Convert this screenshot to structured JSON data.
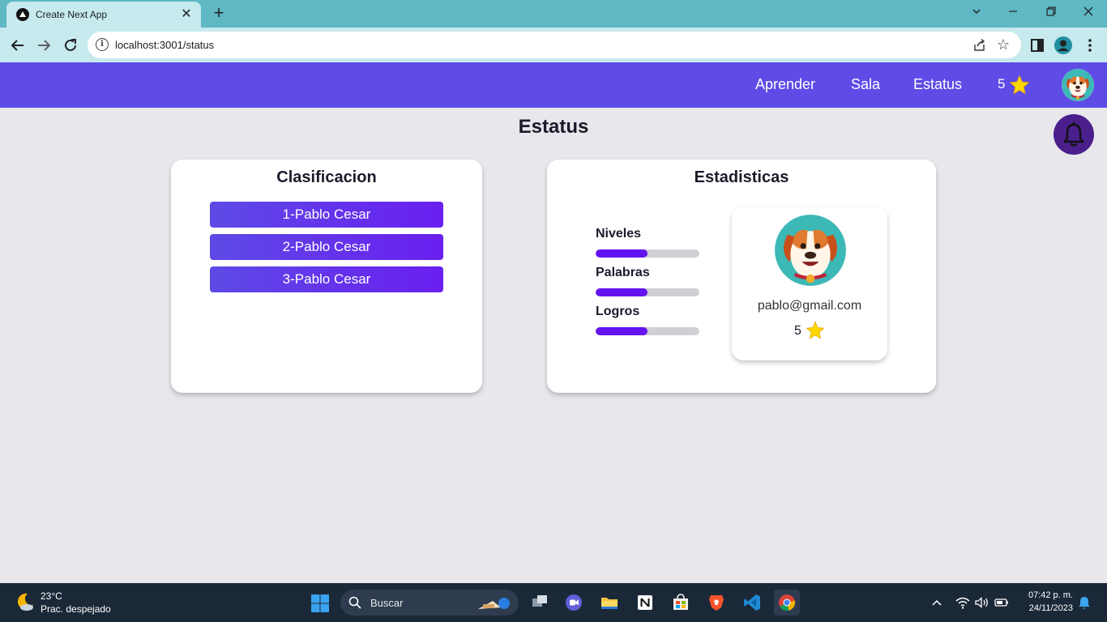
{
  "browser": {
    "tab_title": "Create Next App",
    "url": "localhost:3001/status"
  },
  "header": {
    "nav": [
      "Aprender",
      "Sala",
      "Estatus"
    ],
    "points": "5"
  },
  "page": {
    "title": "Estatus"
  },
  "ranking": {
    "title": "Clasificacion",
    "items": [
      "1-Pablo Cesar",
      "2-Pablo Cesar",
      "3-Pablo Cesar"
    ]
  },
  "stats": {
    "title": "Estadisticas",
    "bars": [
      {
        "label": "Niveles",
        "fraction": 0.5
      },
      {
        "label": "Palabras",
        "fraction": 0.5
      },
      {
        "label": "Logros",
        "fraction": 0.5
      }
    ],
    "profile": {
      "email": "pablo@gmail.com",
      "points": "5"
    }
  },
  "taskbar": {
    "weather_temp": "23°C",
    "weather_desc": "Prac. despejado",
    "search_placeholder": "Buscar",
    "time": "07:42 p. m.",
    "date": "24/11/2023"
  },
  "colors": {
    "header_bg": "#5f4be6",
    "accent": "#6414f0",
    "bell_bg": "#4a1f8c",
    "star": "#ffd700"
  },
  "icons": [
    "back-arrow-icon",
    "forward-arrow-icon",
    "reload-icon",
    "info-icon",
    "share-icon",
    "star-outline-icon",
    "sidebar-icon",
    "profile-icon",
    "kebab-menu-icon",
    "star-icon",
    "bell-icon",
    "dog-avatar",
    "search-icon"
  ]
}
